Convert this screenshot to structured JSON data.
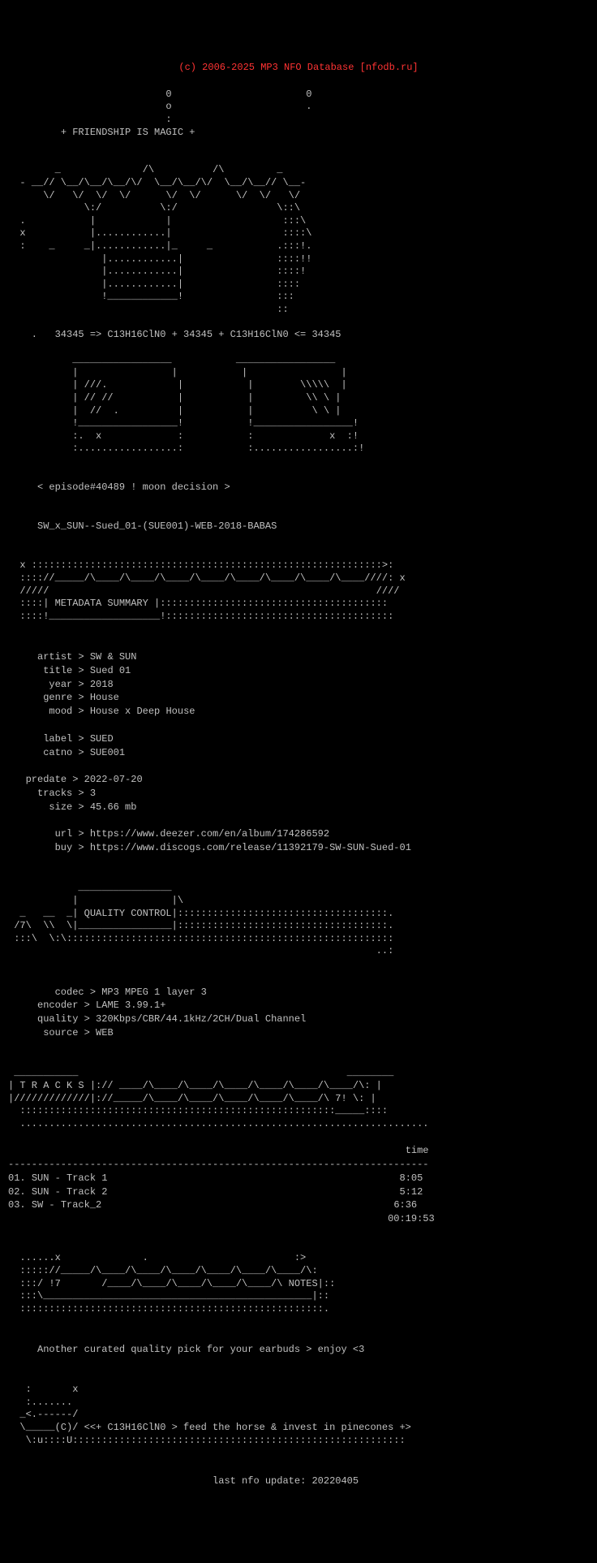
{
  "header": {
    "copyright": "(c) 2006-2025 MP3 NFO Database [nfodb.ru]"
  },
  "ascii": {
    "friendship": "+ FRIENDSHIP IS MAGIC +",
    "art_top": "                           0                       0\n                           o                       .\n                           :\n         + FRIENDSHIP IS MAGIC +\n\n\n        _              /\\          /\\         _\n  - __// \\__/\\__/\\__/\\/  \\__/\\__/\\/  \\__/\\__// \\__-\n      \\/   \\/  \\/  \\/      \\/  \\/      \\/  \\/   \\/\n             \\:/          \\:/                 \\::\\\n  .           |            |                   :::\\\n  x           |............|                   ::::\\\n  :    _     _|............|_     _           .:::!.\n                |............|                ::::!!\n                |............|                ::::!\n                |............|                ::::\n                !____________!                :::\n                                              ::\n\n    .   34345 => C13H16ClN0 + 34345 + C13H16ClN0 <= 34345\n\n           _________________           _________________\n           |                |           |                |\n           | ///.            |           |        \\\\\\\\  |\n           | // //           |           |         \\\\ \\ |\n           |  //  .          |           |          \\ \\ |\n           !_________________!           !_________________!\n           :.  x             :           :             x  :!\n           :.................:           :.................:!\n",
    "episode_line": "< episode#40489 ! moon decision >",
    "release_name": "SW_x_SUN--Sued_01-(SUE001)-WEB-2018-BABAS",
    "metadata_banner_top": "  x :::::::::::::::::::::::::::::::::::::::::::::::::::::::::::::::>::\n  :::://_____/\\____/\\____/\\____/\\____/\\____/\\____/\\____/\\____////: x\n  /////                                                        ////\n  ::::| METADATA SUMMARY |:::::::::::::::::::::::::::::::::::::::\n  ::::!___________________!:::::::::::::::::::::::::::::::::::::::",
    "quality_banner": "            ________________\n           |                |\\n  _   __  _| QUALITY CONTROL|:::::::::::::::::::::::::::::::::::.\n /7\\  \\\\  \\|________________|:::::::::::::::::::::::::::::::::::.\n :::\\  \\:\\::::::::::::::::::::::::::::::::::::::::::::::::::::::\n                                                               ..:",
    "tracks_banner": " ___________                                              ________\n| T R A C K S |:// ____/\\____/\\____/\\____/\\____/\\____/\\____/\\: |\n|/////////////|://_____/\\____/\\____/\\____/\\____/\\____/\\ 7! \\: |\n  :::::::::::::::::::::::::::::::::::::::::::::::::::::_____::::\n  .......................................................................",
    "notes_banner": "  ......x              .                         :>\n  ::::://_____/\\____/\\____/\\____/\\____/\\____/\\____/\\:\n  :::/ !7       /____/\\____/\\____/\\____/\\____/\\ NOTES|::\n  :::\\______________________________________________|::\n  ::::::::::::::::::::::::::::::::::::::::::::::::::::.",
    "footer_art": "   :       x\n   :.......\n  _<.------/          \n  \\ ___(C)/ <<+ C13H16ClN0 > feed the horse & invest in pinecones +>\n   \\:u::::U:::::::::::::::::::::::::::::::::::::::::::::::::::::::::"
  },
  "metadata": {
    "artist_label": "artist",
    "artist_value": "SW & SUN",
    "title_label": "title",
    "title_value": "Sued 01",
    "year_label": "year",
    "year_value": "2018",
    "genre_label": "genre",
    "genre_value": "House",
    "mood_label": "mood",
    "mood_value": "House x Deep House",
    "label_label": "label",
    "label_value": "SUED",
    "catno_label": "catno",
    "catno_value": "SUE001",
    "predate_label": "predate",
    "predate_value": "2022-07-20",
    "tracks_label": "tracks",
    "tracks_value": "3",
    "size_label": "size",
    "size_value": "45.66 mb",
    "url_label": "url",
    "url_value": "https://www.deezer.com/en/album/174286592",
    "buy_label": "buy",
    "buy_value": "https://www.discogs.com/release/11392179-SW-SUN-Sued-01"
  },
  "quality": {
    "codec_label": "codec",
    "codec_value": "MP3 MPEG 1 layer 3",
    "encoder_label": "encoder",
    "encoder_value": "LAME 3.99.1+",
    "quality_label": "quality",
    "quality_value": "320Kbps/CBR/44.1kHz/2CH/Dual Channel",
    "source_label": "source",
    "source_value": "WEB"
  },
  "tracks": {
    "time_header": "time",
    "separator": "------------------------------------------------------------------------",
    "track1_num": "01.",
    "track1_artist": "SUN",
    "track1_title": "Track 1",
    "track1_time": "8:05",
    "track2_num": "02.",
    "track2_artist": "SUN",
    "track2_title": "Track 2",
    "track2_time": "5:12",
    "track3_num": "03.",
    "track3_artist": "SW",
    "track3_title": "Track_2",
    "track3_time": "6:36",
    "total_time": "00:19:53"
  },
  "notes": {
    "text": "Another curated quality pick for your earbuds > enjoy <3"
  },
  "footer": {
    "last_update_label": "last nfo update:",
    "last_update_value": "20220405"
  }
}
